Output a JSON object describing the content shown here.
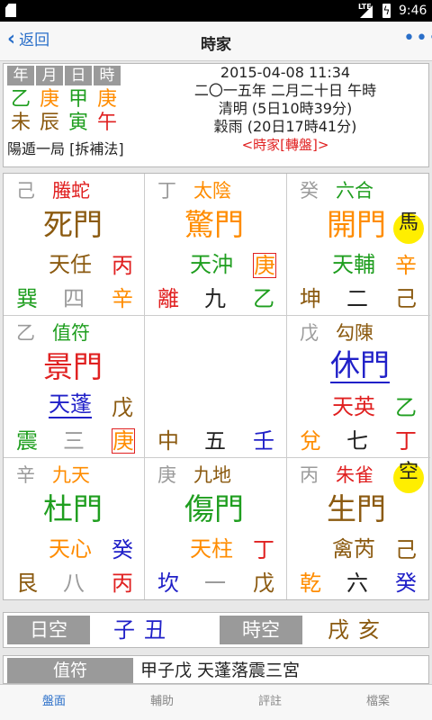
{
  "status": {
    "time": "9:46",
    "network": "LTE"
  },
  "appbar": {
    "back_label": "返回",
    "title": "時家",
    "more_label": "•••"
  },
  "info": {
    "pillar_headers": [
      "年",
      "月",
      "日",
      "時"
    ],
    "stems": [
      "乙",
      "庚",
      "甲",
      "庚"
    ],
    "branches": [
      "未",
      "辰",
      "寅",
      "午"
    ],
    "ju": "陽遁一局 [拆補法]",
    "datetime": "2015-04-08 11:34",
    "lunar": "二〇一五年 二月二十日 午時",
    "term1": "清明 (5日10時39分)",
    "term2": "穀雨 (20日17時41分)",
    "method": "<時家[轉盤]>"
  },
  "palaces": [
    {
      "tl": "己",
      "deity": "螣蛇",
      "door": "死門",
      "star": "天任",
      "earth_right": "丙",
      "trigram": "巽",
      "num": "四",
      "stem": "辛"
    },
    {
      "tl": "丁",
      "deity": "太陰",
      "door": "驚門",
      "star": "天沖",
      "earth_right": "庚",
      "trigram": "離",
      "num": "九",
      "stem": "乙"
    },
    {
      "tl": "癸",
      "deity": "六合",
      "door": "開門",
      "badge": "馬",
      "star": "天輔",
      "earth_right": "辛",
      "trigram": "坤",
      "num": "二",
      "stem": "己"
    },
    {
      "tl": "乙",
      "deity": "值符",
      "door": "景門",
      "star": "天蓬",
      "earth_right": "戊",
      "trigram": "震",
      "num": "三",
      "stem": "庚"
    },
    {
      "trigram": "中",
      "num": "五",
      "stem": "壬"
    },
    {
      "tl": "戊",
      "deity": "勾陳",
      "door": "休門",
      "star": "天英",
      "earth_right": "乙",
      "trigram": "兌",
      "num": "七",
      "stem": "丁"
    },
    {
      "tl": "辛",
      "deity": "九天",
      "door": "杜門",
      "star": "天心",
      "earth_right": "癸",
      "trigram": "艮",
      "num": "八",
      "stem": "丙"
    },
    {
      "tl": "庚",
      "deity": "九地",
      "door": "傷門",
      "star": "天柱",
      "earth_right": "丁",
      "trigram": "坎",
      "num": "一",
      "stem": "戊"
    },
    {
      "tl": "丙",
      "deity": "朱雀",
      "door": "生門",
      "badge": "空",
      "star": "禽芮",
      "earth_right": "己",
      "trigram": "乾",
      "num": "六",
      "stem": "癸"
    }
  ],
  "void": {
    "day_label": "日空",
    "day_value": "子丑",
    "hour_label": "時空",
    "hour_value": "戌亥"
  },
  "zhifu": {
    "label": "值符",
    "value": "甲子戊 天蓬落震三宮"
  },
  "tabs": [
    "盤面",
    "輔助",
    "評註",
    "檔案"
  ],
  "colors": {
    "accent": "#2a6fc9",
    "red": "#e02020",
    "orange": "#ff8c00",
    "green": "#1f9e1f",
    "brown": "#8b5a10",
    "blue": "#2020c8",
    "badge": "#ffee00"
  }
}
